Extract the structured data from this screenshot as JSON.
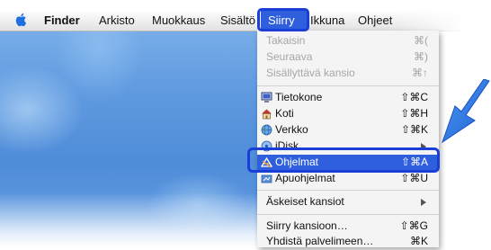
{
  "menubar": {
    "apple_icon": "apple-icon",
    "items": [
      {
        "label": "Finder",
        "bold": true
      },
      {
        "label": "Arkisto"
      },
      {
        "label": "Muokkaus"
      },
      {
        "label": "Sisältö"
      },
      {
        "label": "Siirry",
        "active": true
      },
      {
        "label": "Ikkuna"
      },
      {
        "label": "Ohjeet"
      }
    ]
  },
  "menu": {
    "title": "Siirry",
    "items": [
      {
        "label": "Takaisin",
        "shortcut": "⌘(",
        "disabled": true
      },
      {
        "label": "Seuraava",
        "shortcut": "⌘)",
        "disabled": true
      },
      {
        "label": "Sisällyttävä kansio",
        "shortcut": "⌘↑",
        "disabled": true
      },
      {
        "label": "Tietokone",
        "shortcut": "⇧⌘C",
        "icon": "computer-icon"
      },
      {
        "label": "Koti",
        "shortcut": "⇧⌘H",
        "icon": "home-icon"
      },
      {
        "label": "Verkko",
        "shortcut": "⇧⌘K",
        "icon": "globe-icon"
      },
      {
        "label": "iDisk",
        "icon": "idisk-icon",
        "submenu": true
      },
      {
        "label": "Ohjelmat",
        "shortcut": "⇧⌘A",
        "icon": "applications-icon",
        "highlighted": true
      },
      {
        "label": "Apuohjelmat",
        "shortcut": "⇧⌘U",
        "icon": "utilities-icon"
      },
      {
        "label": "Äskeiset kansiot",
        "submenu": true
      },
      {
        "label": "Siirry kansioon…",
        "shortcut": "⇧⌘G"
      },
      {
        "label": "Yhdistä palvelimeen…",
        "shortcut": "⌘K"
      }
    ]
  },
  "colors": {
    "highlight": "#2f5fdd",
    "callout": "#1a3fd9",
    "arrow": "#1f6fe0"
  },
  "annotations": {
    "pointer_arrow": "pointer-arrow-icon"
  }
}
